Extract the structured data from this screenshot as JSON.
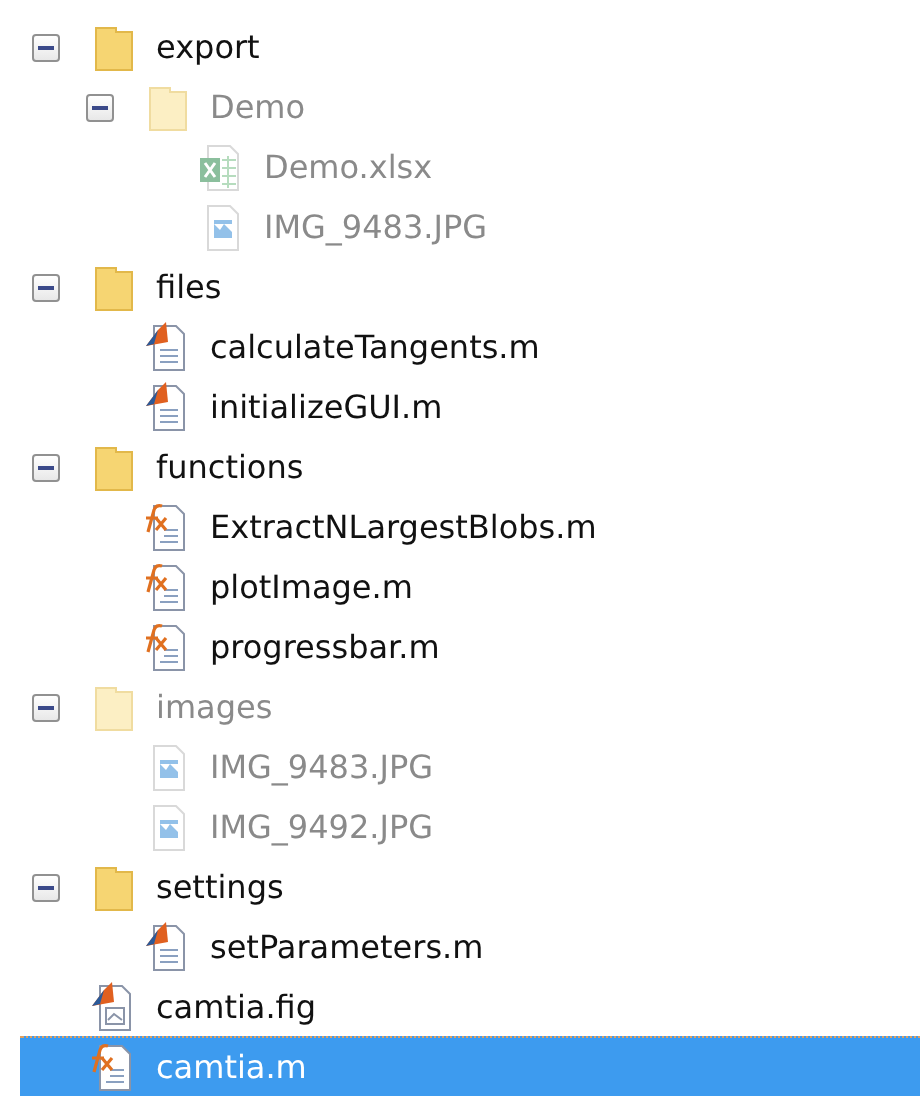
{
  "tree": [
    {
      "kind": "folder",
      "name": "export",
      "expanded": true,
      "dimmed": false,
      "selected": false,
      "children": [
        {
          "kind": "folder",
          "name": "Demo",
          "expanded": true,
          "dimmed": true,
          "selected": false,
          "children": [
            {
              "kind": "excel",
              "name": "Demo.xlsx",
              "dimmed": true,
              "selected": false
            },
            {
              "kind": "image",
              "name": "IMG_9483.JPG",
              "dimmed": true,
              "selected": false
            }
          ]
        }
      ]
    },
    {
      "kind": "folder",
      "name": "files",
      "expanded": true,
      "dimmed": false,
      "selected": false,
      "children": [
        {
          "kind": "script",
          "name": "calculateTangents.m",
          "dimmed": false,
          "selected": false
        },
        {
          "kind": "script",
          "name": "initializeGUI.m",
          "dimmed": false,
          "selected": false
        }
      ]
    },
    {
      "kind": "folder",
      "name": "functions",
      "expanded": true,
      "dimmed": false,
      "selected": false,
      "children": [
        {
          "kind": "function",
          "name": "ExtractNLargestBlobs.m",
          "dimmed": false,
          "selected": false
        },
        {
          "kind": "function",
          "name": "plotImage.m",
          "dimmed": false,
          "selected": false
        },
        {
          "kind": "function",
          "name": "progressbar.m",
          "dimmed": false,
          "selected": false
        }
      ]
    },
    {
      "kind": "folder",
      "name": "images",
      "expanded": true,
      "dimmed": true,
      "selected": false,
      "children": [
        {
          "kind": "image",
          "name": "IMG_9483.JPG",
          "dimmed": true,
          "selected": false
        },
        {
          "kind": "image",
          "name": "IMG_9492.JPG",
          "dimmed": true,
          "selected": false
        }
      ]
    },
    {
      "kind": "folder",
      "name": "settings",
      "expanded": true,
      "dimmed": false,
      "selected": false,
      "children": [
        {
          "kind": "script",
          "name": "setParameters.m",
          "dimmed": false,
          "selected": false
        }
      ]
    },
    {
      "kind": "figure",
      "name": "camtia.fig",
      "dimmed": false,
      "selected": false
    },
    {
      "kind": "function",
      "name": "camtia.m",
      "dimmed": false,
      "selected": true
    }
  ]
}
